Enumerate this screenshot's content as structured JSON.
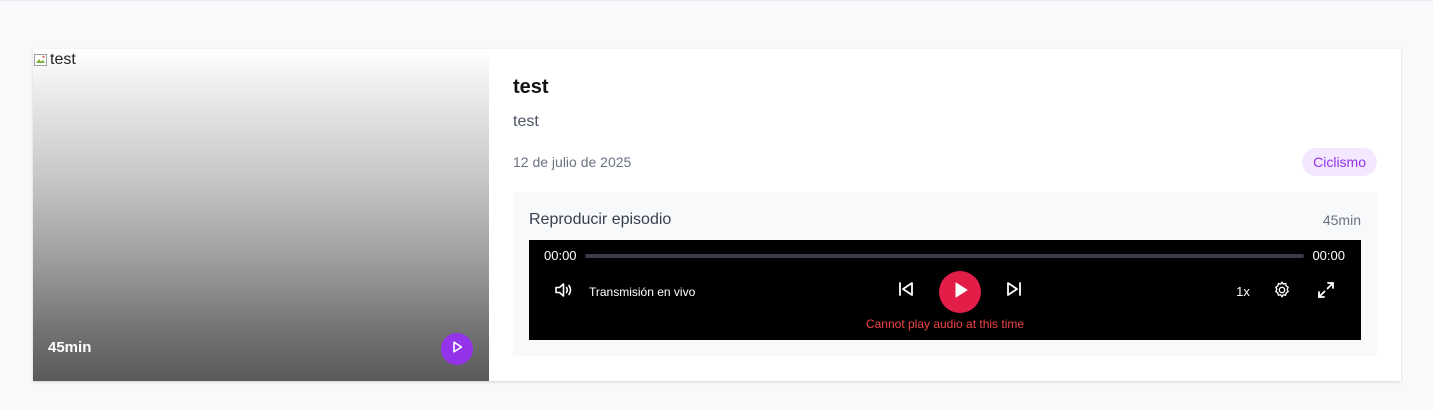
{
  "episode": {
    "image_alt": "test",
    "thumb_duration": "45min",
    "title": "test",
    "description": "test",
    "date": "12 de julio de 2025",
    "category": "Ciclismo"
  },
  "player": {
    "label": "Reproducir episodio",
    "duration": "45min",
    "current_time": "00:00",
    "end_time": "00:00",
    "progress": 0,
    "live_label": "Transmisión en vivo",
    "speed": "1x",
    "error": "Cannot play audio at this time"
  },
  "icons": {
    "thumb_play": "play-icon",
    "volume": "volume-icon",
    "previous": "skip-previous-icon",
    "play": "play-icon",
    "next": "skip-next-icon",
    "settings": "gear-icon",
    "fullscreen": "fullscreen-icon",
    "broken_image": "broken-image-icon"
  },
  "colors": {
    "accent_purple": "#9333ea",
    "tag_bg": "#f3e8ff",
    "play_red": "#e11d48",
    "error_red": "#ef4444",
    "player_bg": "#000000"
  }
}
